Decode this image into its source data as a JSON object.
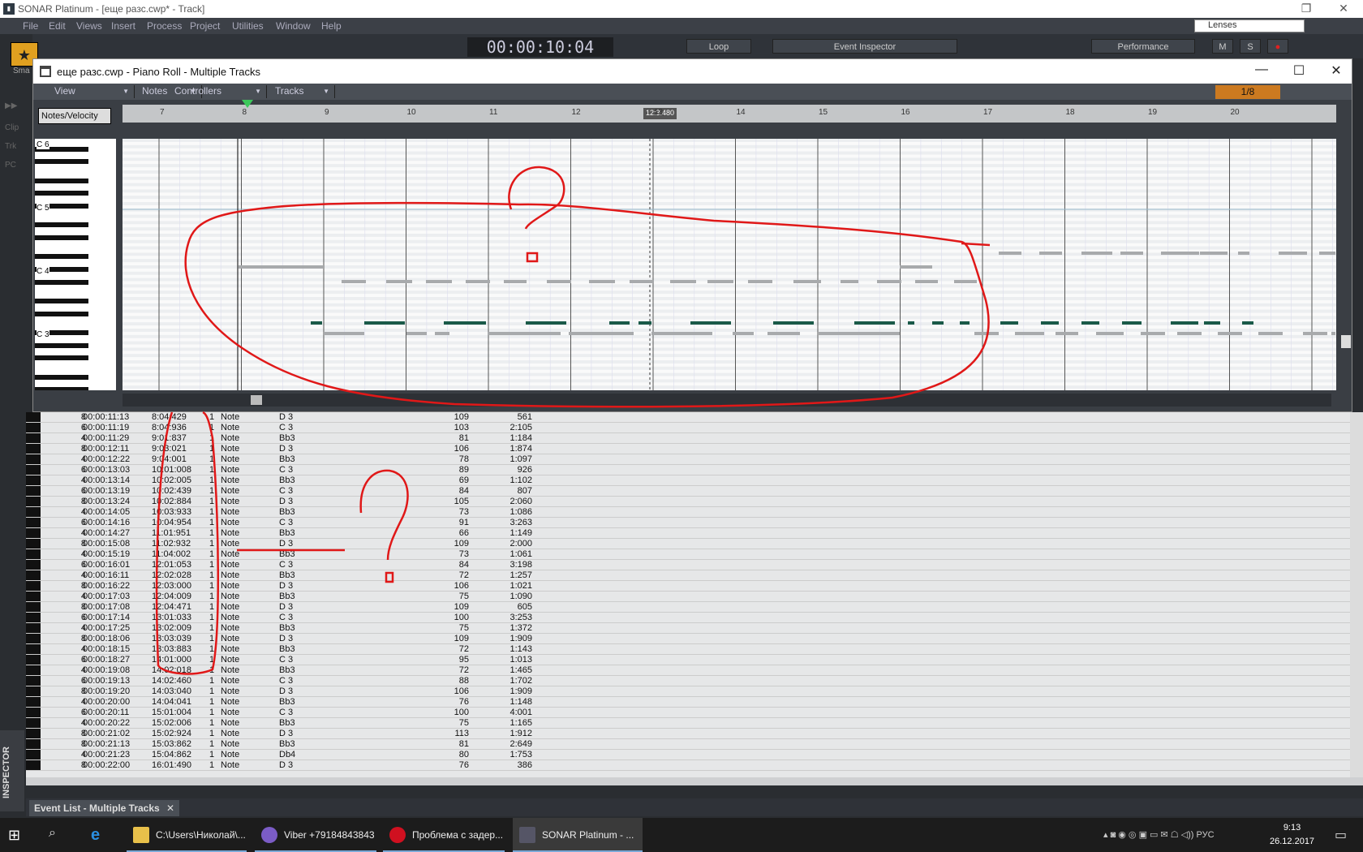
{
  "app": {
    "title": "SONAR Platinum - [еще разс.cwp* - Track]",
    "lenses": "Lenses"
  },
  "menu": [
    "File",
    "Edit",
    "Views",
    "Insert",
    "Process",
    "Project",
    "Utilities",
    "Window",
    "Help"
  ],
  "toolbar": {
    "time": "00:00:10:04",
    "loop": "Loop",
    "event_inspector": "Event Inspector",
    "performance": "Performance",
    "m": "M",
    "s": "S",
    "smart": "Sma"
  },
  "side": {
    "clip": "Clip",
    "trk": "Trk",
    "pc": "PC",
    "inspector": "INSPECTOR"
  },
  "piano_roll": {
    "title": "еще разс.cwp - Piano Roll - Multiple Tracks",
    "menus": [
      "View",
      "Notes",
      "Controllers",
      "Tracks"
    ],
    "snap": "1/8",
    "notes_velocity": "Notes/Velocity",
    "ruler": [
      "7",
      "8",
      "9",
      "10",
      "11",
      "12",
      "13",
      "14",
      "15",
      "16",
      "17",
      "18",
      "19",
      "20"
    ],
    "marker": "12:3:480",
    "octaves": [
      "C 6",
      "C 5",
      "C 4",
      "C 3"
    ],
    "c5_label": "C 5"
  },
  "event_list": {
    "tab": "Event List - Multiple Tracks",
    "rows": [
      [
        "8",
        "00:00:11:13",
        "8:04:429",
        "1",
        "Note",
        "D 3",
        "109",
        "561"
      ],
      [
        "6",
        "00:00:11:19",
        "8:04:936",
        "1",
        "Note",
        "C 3",
        "103",
        "2:105"
      ],
      [
        "4",
        "00:00:11:29",
        "9:01:837",
        "1",
        "Note",
        "Bb3",
        "81",
        "1:184"
      ],
      [
        "8",
        "00:00:12:11",
        "9:03:021",
        "1",
        "Note",
        "D 3",
        "106",
        "1:874"
      ],
      [
        "4",
        "00:00:12:22",
        "9:04:001",
        "1",
        "Note",
        "Bb3",
        "78",
        "1:097"
      ],
      [
        "6",
        "00:00:13:03",
        "10:01:008",
        "1",
        "Note",
        "C 3",
        "89",
        "926"
      ],
      [
        "4",
        "00:00:13:14",
        "10:02:005",
        "1",
        "Note",
        "Bb3",
        "69",
        "1:102"
      ],
      [
        "6",
        "00:00:13:19",
        "10:02:439",
        "1",
        "Note",
        "C 3",
        "84",
        "807"
      ],
      [
        "8",
        "00:00:13:24",
        "10:02:884",
        "1",
        "Note",
        "D 3",
        "105",
        "2:060"
      ],
      [
        "4",
        "00:00:14:05",
        "10:03:933",
        "1",
        "Note",
        "Bb3",
        "73",
        "1:086"
      ],
      [
        "6",
        "00:00:14:16",
        "10:04:954",
        "1",
        "Note",
        "C 3",
        "91",
        "3:263"
      ],
      [
        "4",
        "00:00:14:27",
        "11:01:951",
        "1",
        "Note",
        "Bb3",
        "66",
        "1:149"
      ],
      [
        "8",
        "00:00:15:08",
        "11:02:932",
        "1",
        "Note",
        "D 3",
        "109",
        "2:000"
      ],
      [
        "4",
        "00:00:15:19",
        "11:04:002",
        "1",
        "Note",
        "Bb3",
        "73",
        "1:061"
      ],
      [
        "6",
        "00:00:16:01",
        "12:01:053",
        "1",
        "Note",
        "C 3",
        "84",
        "3:198"
      ],
      [
        "4",
        "00:00:16:11",
        "12:02:028",
        "1",
        "Note",
        "Bb3",
        "72",
        "1:257"
      ],
      [
        "8",
        "00:00:16:22",
        "12:03:000",
        "1",
        "Note",
        "D 3",
        "106",
        "1:021"
      ],
      [
        "4",
        "00:00:17:03",
        "12:04:009",
        "1",
        "Note",
        "Bb3",
        "75",
        "1:090"
      ],
      [
        "8",
        "00:00:17:08",
        "12:04:471",
        "1",
        "Note",
        "D 3",
        "109",
        "605"
      ],
      [
        "6",
        "00:00:17:14",
        "13:01:033",
        "1",
        "Note",
        "C 3",
        "100",
        "3:253"
      ],
      [
        "4",
        "00:00:17:25",
        "13:02:009",
        "1",
        "Note",
        "Bb3",
        "75",
        "1:372"
      ],
      [
        "8",
        "00:00:18:06",
        "13:03:039",
        "1",
        "Note",
        "D 3",
        "109",
        "1:909"
      ],
      [
        "4",
        "00:00:18:15",
        "13:03:883",
        "1",
        "Note",
        "Bb3",
        "72",
        "1:143"
      ],
      [
        "6",
        "00:00:18:27",
        "14:01:000",
        "1",
        "Note",
        "C 3",
        "95",
        "1:013"
      ],
      [
        "4",
        "00:00:19:08",
        "14:02:018",
        "1",
        "Note",
        "Bb3",
        "72",
        "1:465"
      ],
      [
        "6",
        "00:00:19:13",
        "14:02:460",
        "1",
        "Note",
        "C 3",
        "88",
        "1:702"
      ],
      [
        "8",
        "00:00:19:20",
        "14:03:040",
        "1",
        "Note",
        "D 3",
        "106",
        "1:909"
      ],
      [
        "4",
        "00:00:20:00",
        "14:04:041",
        "1",
        "Note",
        "Bb3",
        "76",
        "1:148"
      ],
      [
        "6",
        "00:00:20:11",
        "15:01:004",
        "1",
        "Note",
        "C 3",
        "100",
        "4:001"
      ],
      [
        "4",
        "00:00:20:22",
        "15:02:006",
        "1",
        "Note",
        "Bb3",
        "75",
        "1:165"
      ],
      [
        "8",
        "00:00:21:02",
        "15:02:924",
        "1",
        "Note",
        "D 3",
        "113",
        "1:912"
      ],
      [
        "8",
        "00:00:21:13",
        "15:03:862",
        "1",
        "Note",
        "Bb3",
        "81",
        "2:649"
      ],
      [
        "4",
        "00:00:21:23",
        "15:04:862",
        "1",
        "Note",
        "Db4",
        "80",
        "1:753"
      ],
      [
        "8",
        "00:00:22:00",
        "16:01:490",
        "1",
        "Note",
        "D 3",
        "76",
        "386"
      ]
    ]
  },
  "taskbar": {
    "apps": [
      "C:\\Users\\Николай\\...",
      "Viber +79184843843",
      "Проблема с задер...",
      "SONAR Platinum - ..."
    ],
    "lang": "РУС",
    "time": "9:13",
    "date": "26.12.2017"
  }
}
